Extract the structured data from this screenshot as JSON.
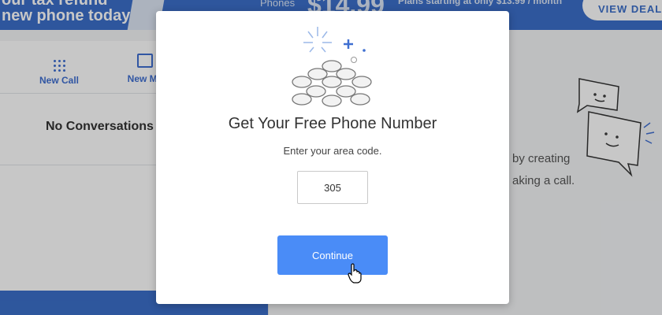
{
  "banner": {
    "line1": "our tax refund",
    "line2": "new phone today!",
    "phones_label": "Phones",
    "price": "$14.99",
    "plans_text": "Plans starting at only $13.99 / month",
    "cta": "VIEW DEAL"
  },
  "sidebar": {
    "new_call_label": "New Call",
    "new_message_label": "New Me",
    "empty_text": "No Conversations"
  },
  "main": {
    "line1": "by creating",
    "line2": "aking a call."
  },
  "modal": {
    "title": "Get Your Free Phone Number",
    "subtitle": "Enter your area code.",
    "area_code_value": "305",
    "continue_label": "Continue"
  },
  "colors": {
    "brand_blue": "#3b6fc9",
    "button_blue": "#4a8cf7"
  },
  "icons": [
    "dialpad-icon",
    "compose-icon",
    "coins-illustration",
    "chat-bubbles-illustration",
    "hand-cursor-icon"
  ]
}
